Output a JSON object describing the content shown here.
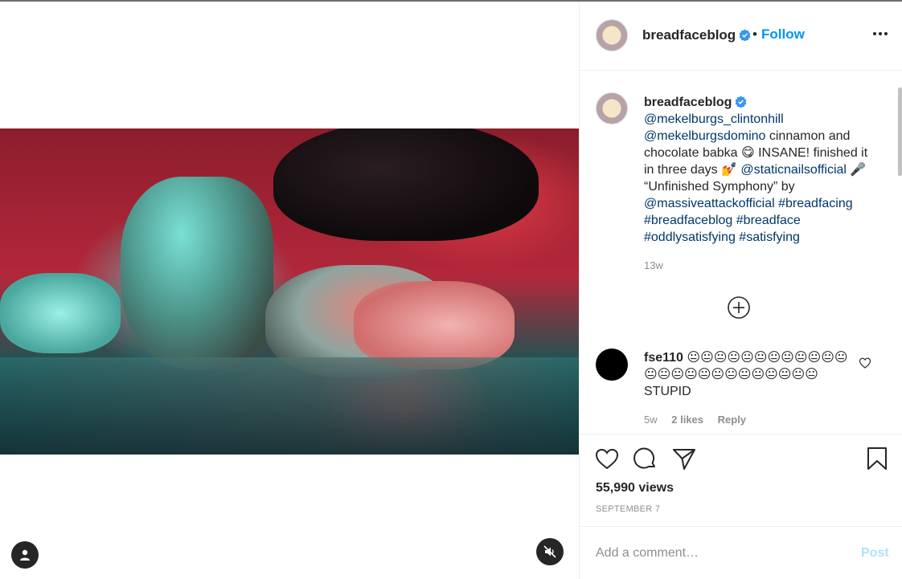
{
  "header": {
    "username": "breadfaceblog",
    "dot": "•",
    "follow_label": "Follow"
  },
  "caption": {
    "username": "breadfaceblog",
    "mention1": "@mekelburgs_clintonhill",
    "mention2": "@mekelburgsdomino",
    "text1": " cinnamon and chocolate babka 😋 INSANE! finished it in three days 💅 ",
    "mention3": "@staticnailsofficial",
    "text2": " 🎤 “Unfinished Symphony” by ",
    "mention4": "@massiveattackofficial",
    "tag1": "#breadfacing",
    "tag2": "#breadfaceblog",
    "tag3": "#breadface",
    "tag4": "#oddlysatisfying",
    "tag5": "#satisfying",
    "time": "13w"
  },
  "comment": {
    "username": "fse110",
    "text": "😐😐😐😐😐😐😐😐😐😐😐😐😐😐😐😐😐😐😐😐😐😐😐😐😐 STUPID",
    "time": "5w",
    "likes": "2 likes",
    "reply_label": "Reply"
  },
  "post": {
    "views": "55,990 views",
    "date": "SEPTEMBER 7"
  },
  "add_comment": {
    "placeholder": "Add a comment…",
    "post_label": "Post"
  },
  "colors": {
    "link": "#00376b",
    "follow": "#0095f6",
    "post_disabled": "#b2dffc",
    "verified": "#3897f0"
  },
  "icons": [
    "verified-badge-icon",
    "more-options-icon",
    "plus-circle-icon",
    "heart-icon",
    "comment-icon",
    "share-icon",
    "bookmark-icon",
    "user-icon",
    "mute-icon"
  ]
}
